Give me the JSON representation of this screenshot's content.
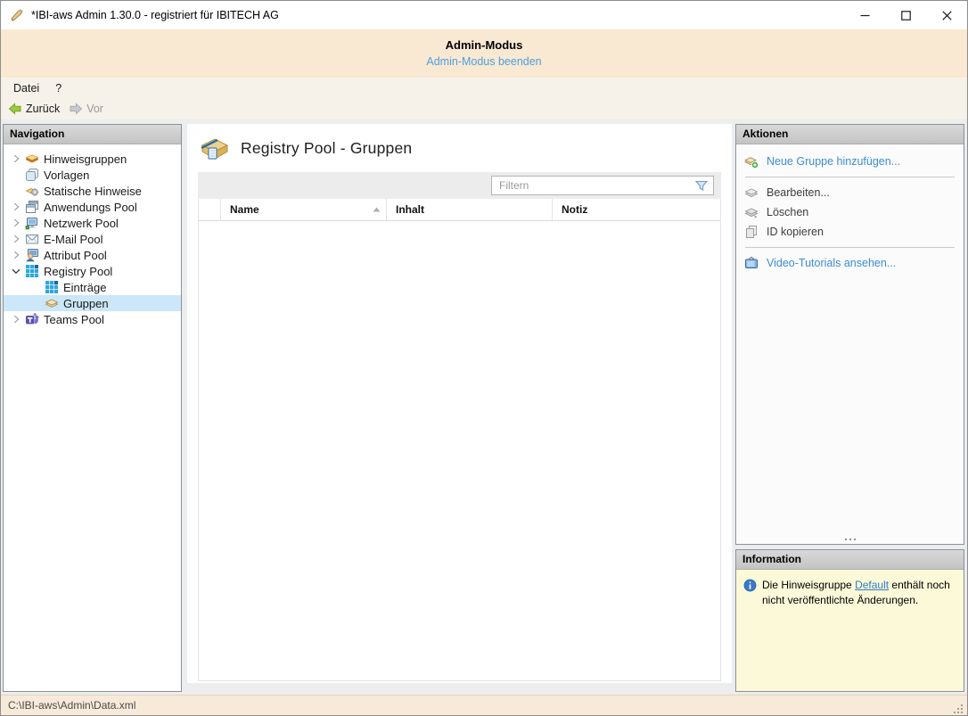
{
  "window": {
    "title": "*IBI-aws Admin 1.30.0 - registriert für IBITECH AG"
  },
  "banner": {
    "title": "Admin-Modus",
    "link": "Admin-Modus beenden"
  },
  "menu": {
    "items": [
      "Datei",
      "?"
    ]
  },
  "toolbar": {
    "back": "Zurück",
    "forward": "Vor"
  },
  "navigation": {
    "header": "Navigation",
    "items": [
      {
        "label": "Hinweisgruppen",
        "icon": "notice-groups-icon",
        "state": "collapsed"
      },
      {
        "label": "Vorlagen",
        "icon": "templates-icon",
        "state": "leaf"
      },
      {
        "label": "Statische Hinweise",
        "icon": "static-notices-icon",
        "state": "leaf"
      },
      {
        "label": "Anwendungs Pool",
        "icon": "application-pool-icon",
        "state": "collapsed"
      },
      {
        "label": "Netzwerk Pool",
        "icon": "network-pool-icon",
        "state": "collapsed"
      },
      {
        "label": "E-Mail Pool",
        "icon": "email-pool-icon",
        "state": "collapsed"
      },
      {
        "label": "Attribut Pool",
        "icon": "attribute-pool-icon",
        "state": "collapsed"
      },
      {
        "label": "Registry Pool",
        "icon": "registry-pool-icon",
        "state": "expanded"
      },
      {
        "label": "Einträge",
        "icon": "registry-entries-icon",
        "state": "leaf-child"
      },
      {
        "label": "Gruppen",
        "icon": "groups-icon",
        "state": "leaf-child-selected"
      },
      {
        "label": "Teams Pool",
        "icon": "teams-pool-icon",
        "state": "collapsed"
      }
    ]
  },
  "main": {
    "title": "Registry Pool - Gruppen",
    "filter": {
      "placeholder": "Filtern"
    },
    "table": {
      "columns": [
        "Name",
        "Inhalt",
        "Notiz"
      ],
      "sort_column": "Name",
      "sort_direction": "asc",
      "rows": []
    }
  },
  "actions": {
    "header": "Aktionen",
    "items": [
      {
        "label": "Neue Gruppe hinzufügen...",
        "type": "link"
      },
      {
        "label": "Bearbeiten...",
        "type": "plain"
      },
      {
        "label": "Löschen",
        "type": "plain"
      },
      {
        "label": "ID kopieren",
        "type": "plain"
      },
      {
        "label": "Video-Tutorials ansehen...",
        "type": "link"
      }
    ]
  },
  "information": {
    "header": "Information",
    "text_before": "Die Hinweisgruppe ",
    "link_label": "Default",
    "text_after": " enthält noch nicht veröffentlichte Änderungen."
  },
  "statusbar": {
    "path": "C:\\IBI-aws\\Admin\\Data.xml"
  },
  "colors": {
    "banner_bg": "#f9e8d2",
    "link_blue": "#3a8dd4",
    "banner_link_blue": "#4aa0e0",
    "selection_blue": "#cbe7f8",
    "info_bg": "#fbf9d8",
    "status_bg": "#f7ead8",
    "panel_header_gray": "#c9c9c9"
  }
}
